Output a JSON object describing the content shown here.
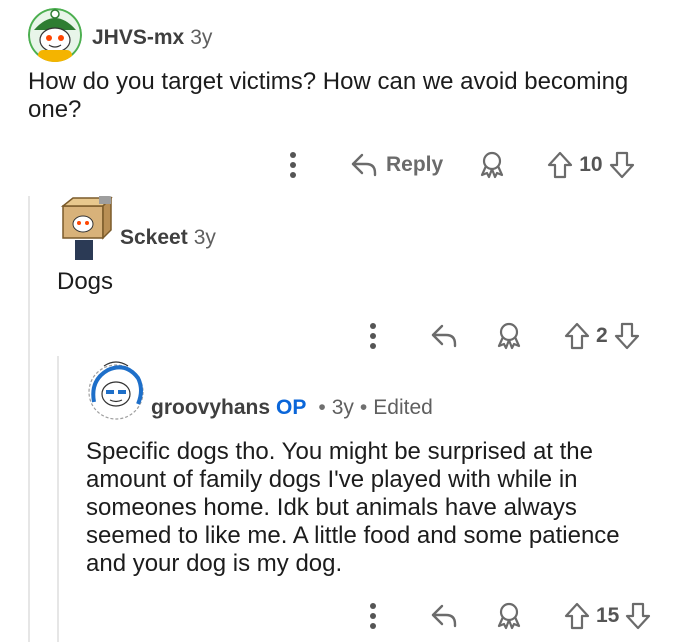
{
  "comments": [
    {
      "username": "JHVS-mx",
      "age": "3y",
      "body": "How do you target victims? How can we avoid becoming one?",
      "actions": {
        "more_icon": "more-vertical-icon",
        "reply_label": "Reply",
        "award_icon": "award-icon",
        "score": "10"
      }
    },
    {
      "username": "Sckeet",
      "age": "3y",
      "body": "Dogs",
      "actions": {
        "more_icon": "more-vertical-icon",
        "award_icon": "award-icon",
        "score": "2"
      }
    },
    {
      "username": "groovyhans",
      "op_badge": "OP",
      "separator": "•",
      "age": "3y",
      "edited": "Edited",
      "body": "Specific dogs tho. You might be surprised at the amount of family dogs I've played with while in someones home. Idk but animals have always seemed to like me. A little food and some patience and your dog is my dog.",
      "actions": {
        "more_icon": "more-vertical-icon",
        "award_icon": "award-icon",
        "score": "15"
      }
    }
  ],
  "colors": {
    "accent_op": "#0a66d9",
    "thread_line": "#e6e6e6",
    "icon_gray": "#767676"
  }
}
